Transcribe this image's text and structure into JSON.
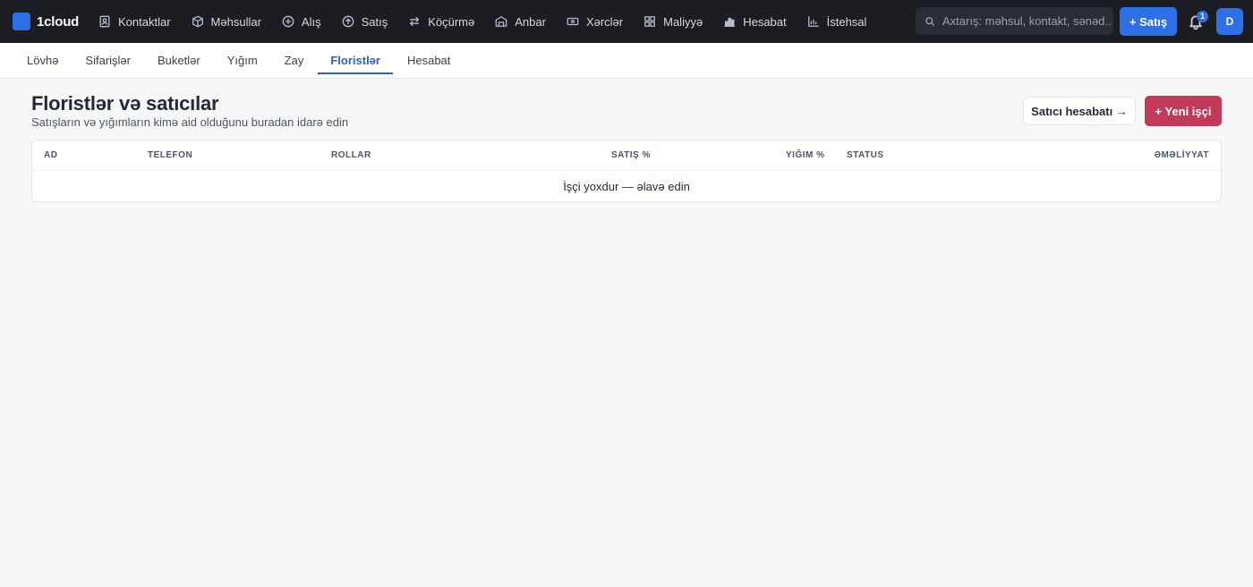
{
  "app": {
    "name": "1cloud"
  },
  "nav": {
    "items": [
      {
        "label": "Kontaktlar",
        "icon": "contacts-icon"
      },
      {
        "label": "Məhsullar",
        "icon": "box-icon"
      },
      {
        "label": "Alış",
        "icon": "plus-circle-icon"
      },
      {
        "label": "Satış",
        "icon": "arrow-circle-icon"
      },
      {
        "label": "Köçürmə",
        "icon": "transfer-icon"
      },
      {
        "label": "Anbar",
        "icon": "warehouse-icon"
      },
      {
        "label": "Xərclər",
        "icon": "banknote-icon"
      },
      {
        "label": "Maliyyə",
        "icon": "grid-icon"
      },
      {
        "label": "Hesabat",
        "icon": "bar-chart-icon"
      },
      {
        "label": "İstehsal",
        "icon": "factory-chart-icon"
      }
    ]
  },
  "search": {
    "placeholder": "Axtarış: məhsul, kontakt, sənəd..."
  },
  "header_actions": {
    "sale_button": "+ Satış",
    "notification_count": "1",
    "avatar_initial": "D"
  },
  "subnav": {
    "tabs": [
      {
        "label": "Lövhə"
      },
      {
        "label": "Sifarişlər"
      },
      {
        "label": "Buketlər"
      },
      {
        "label": "Yığım"
      },
      {
        "label": "Zay"
      },
      {
        "label": "Floristlər",
        "active": true
      },
      {
        "label": "Hesabat"
      }
    ]
  },
  "page": {
    "title": "Floristlər və satıcılar",
    "subtitle": "Satışların və yığımların kimə aid olduğunu buradan idarə edin",
    "account_button": "Satıcı hesabatı →",
    "new_button": "+ Yeni işçi"
  },
  "table": {
    "columns": [
      "AD",
      "TELEFON",
      "ROLLAR",
      "SATIŞ %",
      "YIĞIM %",
      "STATUS",
      "ƏMƏLİYYAT"
    ],
    "empty_text": "İşçi yoxdur — əlavə edin"
  },
  "colors": {
    "topbar": "#1b1d22",
    "accent": "#2f6fe6",
    "danger": "#c23a5a",
    "active_tab": "#2f5fc4"
  }
}
